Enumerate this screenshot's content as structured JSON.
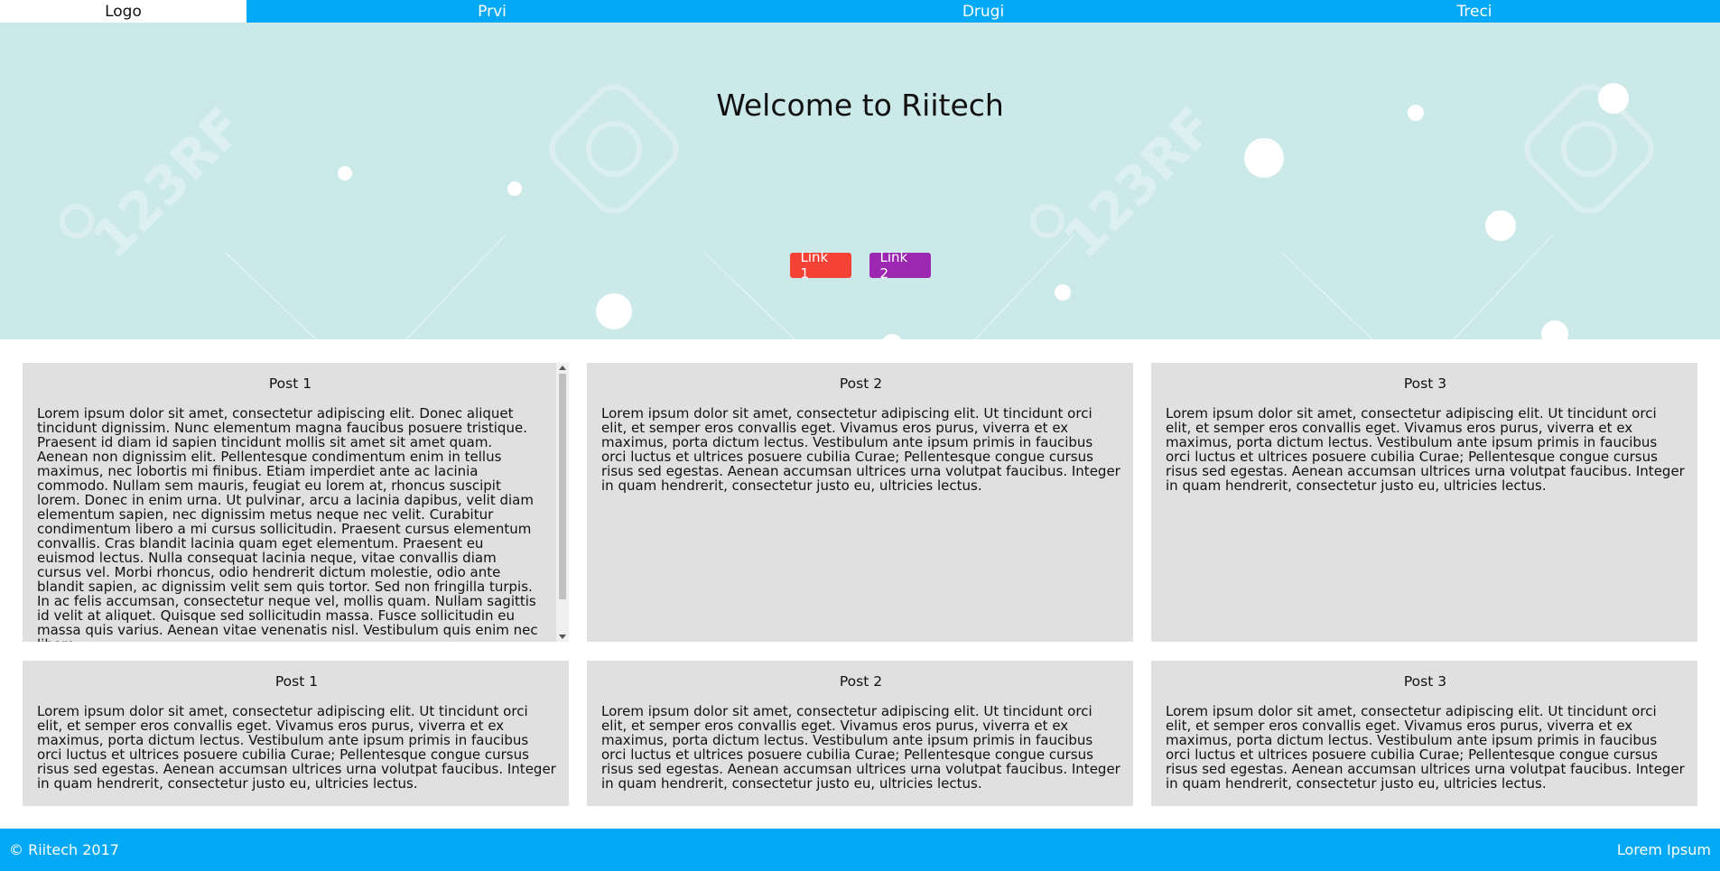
{
  "nav": {
    "logo": "Logo",
    "items": [
      {
        "label": "Prvi"
      },
      {
        "label": "Drugi"
      },
      {
        "label": "Treci"
      }
    ]
  },
  "hero": {
    "title": "Welcome to Riitech",
    "link1": "Link 1",
    "link2": "Link 2",
    "colors": {
      "background": "#cce9ea",
      "link1": "#f44336",
      "link2": "#9c27b0"
    }
  },
  "posts": {
    "row1": [
      {
        "title": "Post 1",
        "body": "Lorem ipsum dolor sit amet, consectetur adipiscing elit. Donec aliquet tincidunt dignissim. Nunc elementum magna faucibus posuere tristique. Praesent id diam id sapien tincidunt mollis sit amet sit amet quam. Aenean non dignissim elit. Pellentesque condimentum enim in tellus maximus, nec lobortis mi finibus. Etiam imperdiet ante ac lacinia commodo. Nullam sem mauris, feugiat eu lorem at, rhoncus suscipit lorem. Donec in enim urna. Ut pulvinar, arcu a lacinia dapibus, velit diam elementum sapien, nec dignissim metus neque nec velit. Curabitur condimentum libero a mi cursus sollicitudin. Praesent cursus elementum convallis. Cras blandit lacinia quam eget elementum. Praesent eu euismod lectus. Nulla consequat lacinia neque, vitae convallis diam cursus vel. Morbi rhoncus, odio hendrerit dictum molestie, odio ante blandit sapien, ac dignissim velit sem quis tortor. Sed non fringilla turpis. In ac felis accumsan, consectetur neque vel, mollis quam. Nullam sagittis id velit at aliquet. Quisque sed sollicitudin massa. Fusce sollicitudin eu massa quis varius. Aenean vitae venenatis nisl. Vestibulum quis enim nec libero"
      },
      {
        "title": "Post 2",
        "body": "Lorem ipsum dolor sit amet, consectetur adipiscing elit. Ut tincidunt orci elit, et semper eros convallis eget. Vivamus eros purus, viverra et ex maximus, porta dictum lectus. Vestibulum ante ipsum primis in faucibus orci luctus et ultrices posuere cubilia Curae; Pellentesque congue cursus risus sed egestas. Aenean accumsan ultrices urna volutpat faucibus. Integer in quam hendrerit, consectetur justo eu, ultricies lectus."
      },
      {
        "title": "Post 3",
        "body": "Lorem ipsum dolor sit amet, consectetur adipiscing elit. Ut tincidunt orci elit, et semper eros convallis eget. Vivamus eros purus, viverra et ex maximus, porta dictum lectus. Vestibulum ante ipsum primis in faucibus orci luctus et ultrices posuere cubilia Curae; Pellentesque congue cursus risus sed egestas. Aenean accumsan ultrices urna volutpat faucibus. Integer in quam hendrerit, consectetur justo eu, ultricies lectus."
      }
    ],
    "row2": [
      {
        "title": "Post 1",
        "body": "Lorem ipsum dolor sit amet, consectetur adipiscing elit. Ut tincidunt orci elit, et semper eros convallis eget. Vivamus eros purus, viverra et ex maximus, porta dictum lectus. Vestibulum ante ipsum primis in faucibus orci luctus et ultrices posuere cubilia Curae; Pellentesque congue cursus risus sed egestas. Aenean accumsan ultrices urna volutpat faucibus. Integer in quam hendrerit, consectetur justo eu, ultricies lectus."
      },
      {
        "title": "Post 2",
        "body": "Lorem ipsum dolor sit amet, consectetur adipiscing elit. Ut tincidunt orci elit, et semper eros convallis eget. Vivamus eros purus, viverra et ex maximus, porta dictum lectus. Vestibulum ante ipsum primis in faucibus orci luctus et ultrices posuere cubilia Curae; Pellentesque congue cursus risus sed egestas. Aenean accumsan ultrices urna volutpat faucibus. Integer in quam hendrerit, consectetur justo eu, ultricies lectus."
      },
      {
        "title": "Post 3",
        "body": "Lorem ipsum dolor sit amet, consectetur adipiscing elit. Ut tincidunt orci elit, et semper eros convallis eget. Vivamus eros purus, viverra et ex maximus, porta dictum lectus. Vestibulum ante ipsum primis in faucibus orci luctus et ultrices posuere cubilia Curae; Pellentesque congue cursus risus sed egestas. Aenean accumsan ultrices urna volutpat faucibus. Integer in quam hendrerit, consectetur justo eu, ultricies lectus."
      }
    ]
  },
  "footer": {
    "copyright": "© Riitech 2017",
    "right_link": "Lorem Ipsum"
  },
  "theme": {
    "accent": "#03a9f4",
    "card": "#e0e0e0"
  }
}
